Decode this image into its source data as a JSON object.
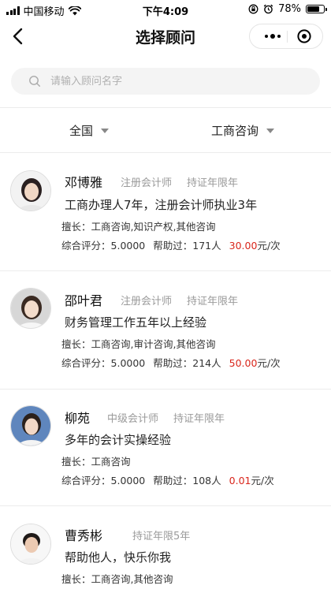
{
  "status_bar": {
    "carrier": "中国移动",
    "time": "下午4:09",
    "battery": "78%",
    "battery_level": 0.78
  },
  "nav": {
    "title": "选择顾问"
  },
  "search": {
    "placeholder": "请输入顾问名字",
    "value": ""
  },
  "filters": {
    "region": "全国",
    "category": "工商咨询"
  },
  "advisors": [
    {
      "name": "邓博雅",
      "tag1": "注册会计师",
      "tag2": "持证年限年",
      "intro": "工商办理人7年，注册会计师执业3年",
      "specialty": "擅长：工商咨询,知识产权,其他咨询",
      "score_label": "综合评分：",
      "score": "5.0000",
      "helped_label": "帮助过：",
      "helped": "171人",
      "price": "30.00",
      "price_unit": "元/次"
    },
    {
      "name": "邵叶君",
      "tag1": "注册会计师",
      "tag2": "持证年限年",
      "intro": "财务管理工作五年以上经验",
      "specialty": "擅长：工商咨询,审计咨询,其他咨询",
      "score_label": "综合评分：",
      "score": "5.0000",
      "helped_label": "帮助过：",
      "helped": "214人",
      "price": "50.00",
      "price_unit": "元/次"
    },
    {
      "name": "柳苑",
      "tag1": "中级会计师",
      "tag2": "持证年限年",
      "intro": "多年的会计实操经验",
      "specialty": "擅长：工商咨询",
      "score_label": "综合评分：",
      "score": "5.0000",
      "helped_label": "帮助过：",
      "helped": "108人",
      "price": "0.01",
      "price_unit": "元/次"
    },
    {
      "name": "曹秀彬",
      "tag1": "持证年限5年",
      "intro": "帮助他人，快乐你我",
      "specialty": "擅长：工商咨询,其他咨询"
    }
  ],
  "colors": {
    "price": "#d9261c",
    "tag": "#9a9a9a",
    "search_bg": "#f4f4f4"
  }
}
